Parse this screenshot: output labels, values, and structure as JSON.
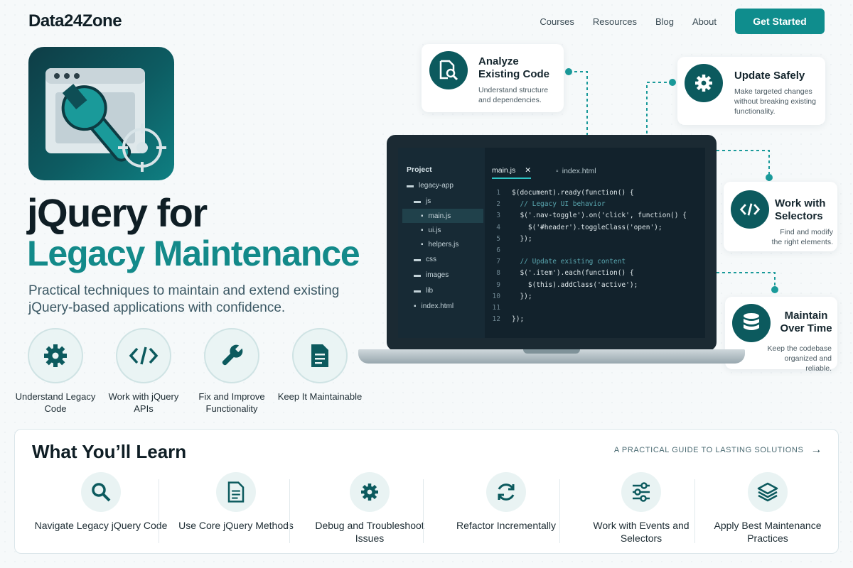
{
  "nav": {
    "logo": "Data24Zone",
    "links": [
      "Courses",
      "Resources",
      "Blog",
      "About"
    ],
    "cta": "Get Started"
  },
  "hero": {
    "title_line1": "jQuery for",
    "title_line2": "Legacy Maintenance",
    "subtitle": "Practical techniques to maintain and extend existing jQuery-based applications with confidence."
  },
  "features": [
    {
      "label": "Understand Legacy Code",
      "icon": "gear-icon"
    },
    {
      "label": "Work with jQuery APIs",
      "icon": "code-icon"
    },
    {
      "label": "Fix and Improve Functionality",
      "icon": "wrench-icon"
    },
    {
      "label": "Keep It Maintainable",
      "icon": "document-icon"
    }
  ],
  "callouts": [
    {
      "title": "Analyze Existing Code",
      "desc": "Understand structure and dependencies.",
      "icon": "document-search-icon"
    },
    {
      "title": "Update Safely",
      "desc": "Make targeted changes without breaking existing functionality.",
      "icon": "gear-icon"
    },
    {
      "title": "Work with Selectors",
      "desc": "Find and modify the right elements.",
      "icon": "code-icon"
    },
    {
      "title": "Maintain Over Time",
      "desc": "Keep the codebase organized and reliable.",
      "icon": "database-icon"
    }
  ],
  "editor": {
    "project_label": "Project",
    "tree": [
      "legacy-app",
      "js",
      "main.js",
      "ui.js",
      "helpers.js",
      "css",
      "images",
      "lib",
      "index.html"
    ],
    "tabs": [
      "main.js",
      "index.html"
    ],
    "lines": [
      "$(document).ready(function() {",
      "  // Legacy UI behavior",
      "  $('.nav-toggle').on('click', function() {",
      "    $('#header').toggleClass('open');",
      "  });",
      "",
      "  // Update existing content",
      "  $('.item').each(function() {",
      "    $(this).addClass('active');",
      "  });",
      "",
      "});"
    ],
    "line_numbers": [
      "1",
      "2",
      "3",
      "4",
      "5",
      "6",
      "7",
      "8",
      "9",
      "10",
      "11",
      "12"
    ]
  },
  "learn": {
    "heading": "What You’ll Learn",
    "tagline": "A PRACTICAL GUIDE TO LASTING SOLUTIONS",
    "items": [
      {
        "label": "Navigate Legacy jQuery Code",
        "icon": "search-icon"
      },
      {
        "label": "Use Core jQuery Methods",
        "icon": "document-icon"
      },
      {
        "label": "Debug and Troubleshoot Issues",
        "icon": "gear-icon"
      },
      {
        "label": "Refactor Incrementally",
        "icon": "refresh-icon"
      },
      {
        "label": "Work with Events and Selectors",
        "icon": "sliders-icon"
      },
      {
        "label": "Apply Best Maintenance Practices",
        "icon": "layers-icon"
      }
    ]
  },
  "colors": {
    "accent": "#138a8a",
    "dark": "#0f1e25",
    "icon_bg": "#0c5a5e"
  }
}
